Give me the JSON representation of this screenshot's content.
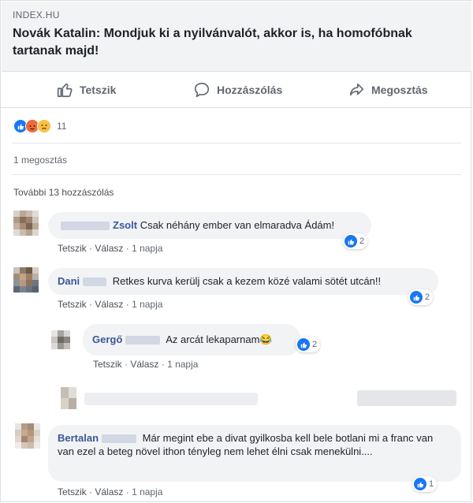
{
  "link": {
    "source": "INDEX.HU",
    "headline": "Novák Katalin: Mondjuk ki a nyilvánvalót, akkor is, ha homofóbnak tartanak majd!"
  },
  "actions": {
    "like": "Tetszik",
    "comment": "Hozzászólás",
    "share": "Megosztás"
  },
  "reactions": {
    "count": "11",
    "icons": [
      "like-icon",
      "angry-icon",
      "sad-icon"
    ]
  },
  "shares": "1 megosztás",
  "more_comments": "További 13 hozzászólás",
  "comments": [
    {
      "name": "Zsolt",
      "text": "Csak néhány ember van elmaradva Ádám!",
      "likes": "2",
      "like": "Tetszik",
      "reply": "Válasz",
      "time": "1 napja"
    },
    {
      "name": "Dani",
      "text": "Retkes kurva kerülj csak a kezem közé valami sötét utcán!!",
      "likes": "2",
      "like": "Tetszik",
      "reply": "Válasz",
      "time": "1 napja"
    },
    {
      "name": "Gergő",
      "text": "Az arcát lekaparnam😂",
      "likes": "2",
      "like": "Tetszik",
      "reply": "Válasz",
      "time": "1 napja"
    },
    {
      "name": "Bertalan",
      "text": "Már megint ebe a divat gyilkosba kell bele botlani mi a franc van van ezel a beteg növel ithon tényleg nem lehet élni csak menekülni....",
      "likes": "1",
      "like": "Tetszik",
      "reply": "Válasz",
      "time": "1 napja"
    }
  ],
  "colors": {
    "brand": "#1877f2",
    "name": "#385898",
    "bubble": "#f2f3f5",
    "muted": "#606770"
  }
}
